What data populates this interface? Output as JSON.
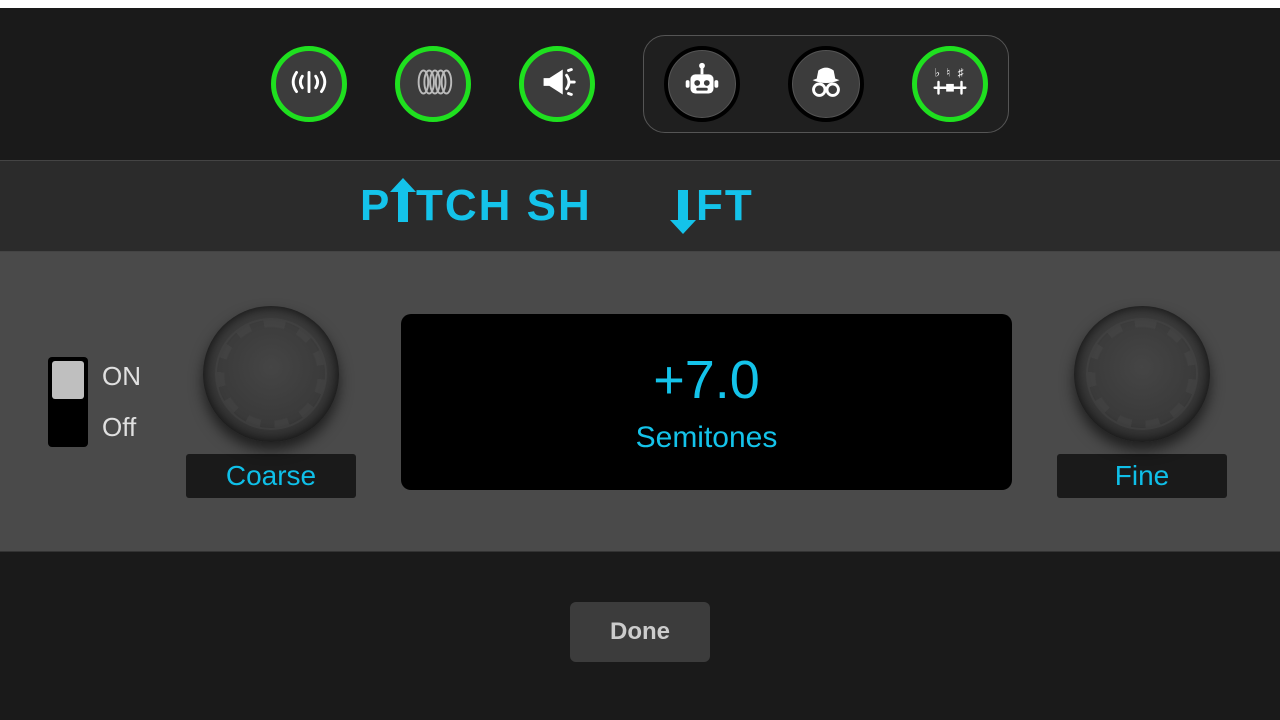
{
  "colors": {
    "accent": "#14c3ea",
    "active_ring": "#1fe01f"
  },
  "topbar": {
    "effects": [
      {
        "name": "reverb",
        "icon": "waves-icon",
        "active": true
      },
      {
        "name": "flanger",
        "icon": "coil-icon",
        "active": true
      },
      {
        "name": "megaphone",
        "icon": "megaphone-icon",
        "active": true
      }
    ],
    "group": [
      {
        "name": "robot",
        "icon": "robot-icon",
        "active": false
      },
      {
        "name": "incognito",
        "icon": "incognito-icon",
        "active": false
      },
      {
        "name": "pitch-shift",
        "icon": "tuning-icon",
        "active": true
      }
    ]
  },
  "title": {
    "text": "PITCH SHIFT",
    "words": [
      "P",
      "TCH SH",
      "FT"
    ]
  },
  "panel": {
    "on_label": "ON",
    "off_label": "Off",
    "enabled": true,
    "coarse_label": "Coarse",
    "fine_label": "Fine",
    "coarse_value": 7,
    "fine_value": 0.0,
    "display_value": "+7.0",
    "display_unit": "Semitones"
  },
  "footer": {
    "done_label": "Done"
  }
}
